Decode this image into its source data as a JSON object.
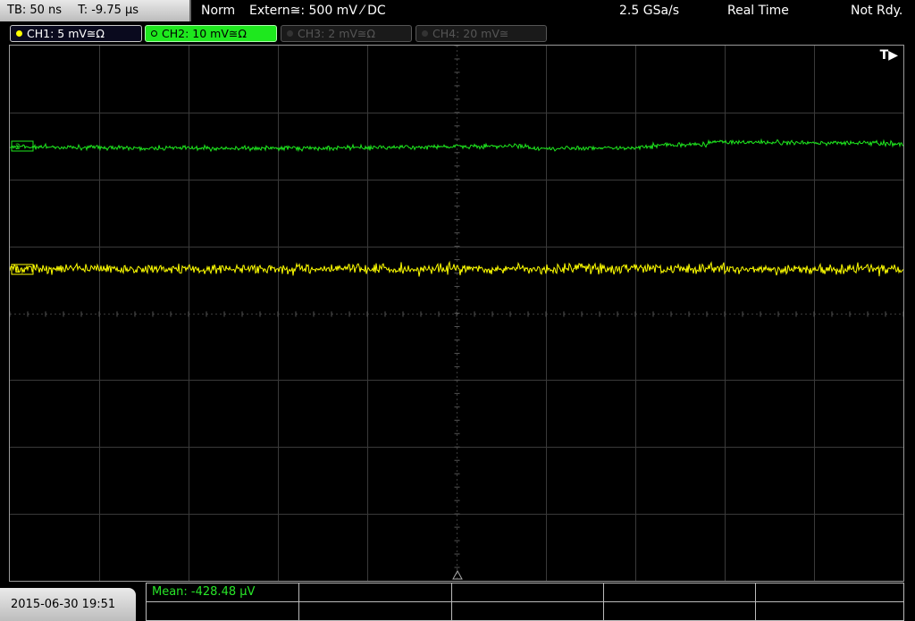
{
  "topbar": {
    "timebase": "TB: 50 ns",
    "trigger_time": "T: -9.75 µs",
    "mode": "Norm",
    "trigger_source": "Extern≅: 500 mV ⁄ DC",
    "sample_rate": "2.5 GSa/s",
    "acq_mode": "Real Time",
    "status": "Not Rdy."
  },
  "channels": [
    {
      "label": "CH1: 5 mV≅Ω",
      "color": "#ffff00",
      "active": true
    },
    {
      "label": "CH2: 10 mV≅Ω",
      "color": "#1ee81e",
      "active": true
    },
    {
      "label": "CH3: 2 mV≅Ω",
      "color": "#555555",
      "active": false
    },
    {
      "label": "CH4: 20 mV≅",
      "color": "#555555",
      "active": false
    }
  ],
  "screen": {
    "trigger_marker": "T▶",
    "ch1_marker": "1",
    "ch2_marker": "2"
  },
  "bottom": {
    "datetime": "2015-06-30 19:51",
    "measurement": "Mean: -428.48 µV"
  },
  "colors": {
    "ch1": "#ffff00",
    "ch2": "#1ee81e",
    "grid": "#3a3a3a"
  }
}
